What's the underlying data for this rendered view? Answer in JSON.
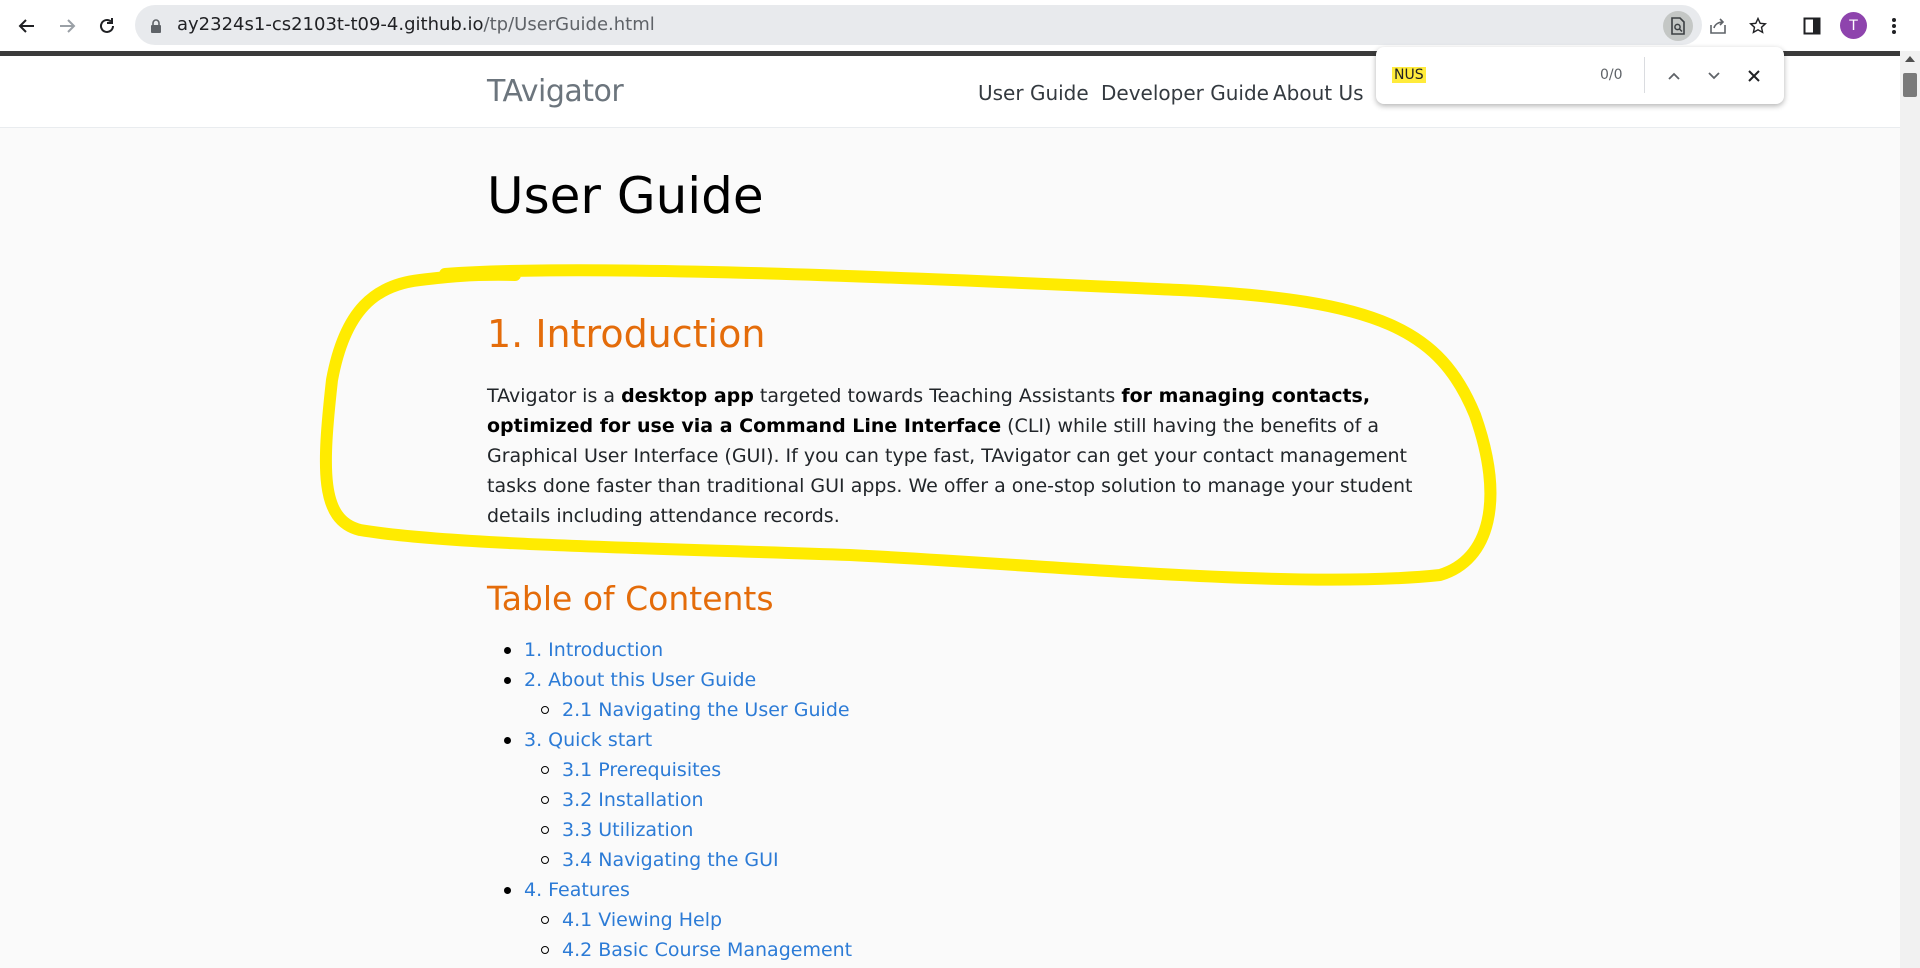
{
  "browser": {
    "url_host": "ay2324s1-cs2103t-t09-4.github.io",
    "url_path": "/tp/UserGuide.html",
    "profile_initial": "T"
  },
  "find_bar": {
    "query": "NUS",
    "count": "0/0"
  },
  "site": {
    "brand": "TAvigator",
    "nav": [
      "User Guide",
      "Developer Guide",
      "About Us"
    ]
  },
  "page": {
    "title": "User Guide",
    "intro_heading": "1. Introduction",
    "intro": {
      "t1": "TAvigator is a ",
      "b1": "desktop app",
      "t2": " targeted towards Teaching Assistants ",
      "b2": "for managing contacts, optimized for use via a Command Line Interface",
      "t3": " (CLI) while still having the benefits of a Graphical User Interface (GUI). If you can type fast, TAvigator can get your contact management tasks done faster than traditional GUI apps. We offer a one-stop solution to manage your student details including attendance records."
    },
    "toc_heading": "Table of Contents",
    "toc": [
      {
        "label": "1. Introduction",
        "level": 1
      },
      {
        "label": "2. About this User Guide",
        "level": 1
      },
      {
        "label": "2.1 Navigating the User Guide",
        "level": 2
      },
      {
        "label": "3. Quick start",
        "level": 1
      },
      {
        "label": "3.1 Prerequisites",
        "level": 2
      },
      {
        "label": "3.2 Installation",
        "level": 2
      },
      {
        "label": "3.3 Utilization",
        "level": 2
      },
      {
        "label": "3.4 Navigating the GUI",
        "level": 2
      },
      {
        "label": "4. Features",
        "level": 1
      },
      {
        "label": "4.1 Viewing Help",
        "level": 2
      },
      {
        "label": "4.2 Basic Course Management",
        "level": 2
      }
    ]
  },
  "colors": {
    "heading_orange": "#e46c0a",
    "link_blue": "#2c7bd6",
    "annotation_yellow": "#ffeb00"
  },
  "icons": [
    "back-icon",
    "forward-icon",
    "reload-icon",
    "lock-icon",
    "find-in-page-icon",
    "share-icon",
    "bookmark-star-icon",
    "side-panel-icon",
    "menu-icon",
    "chevron-up-icon",
    "chevron-down-icon",
    "close-icon"
  ]
}
